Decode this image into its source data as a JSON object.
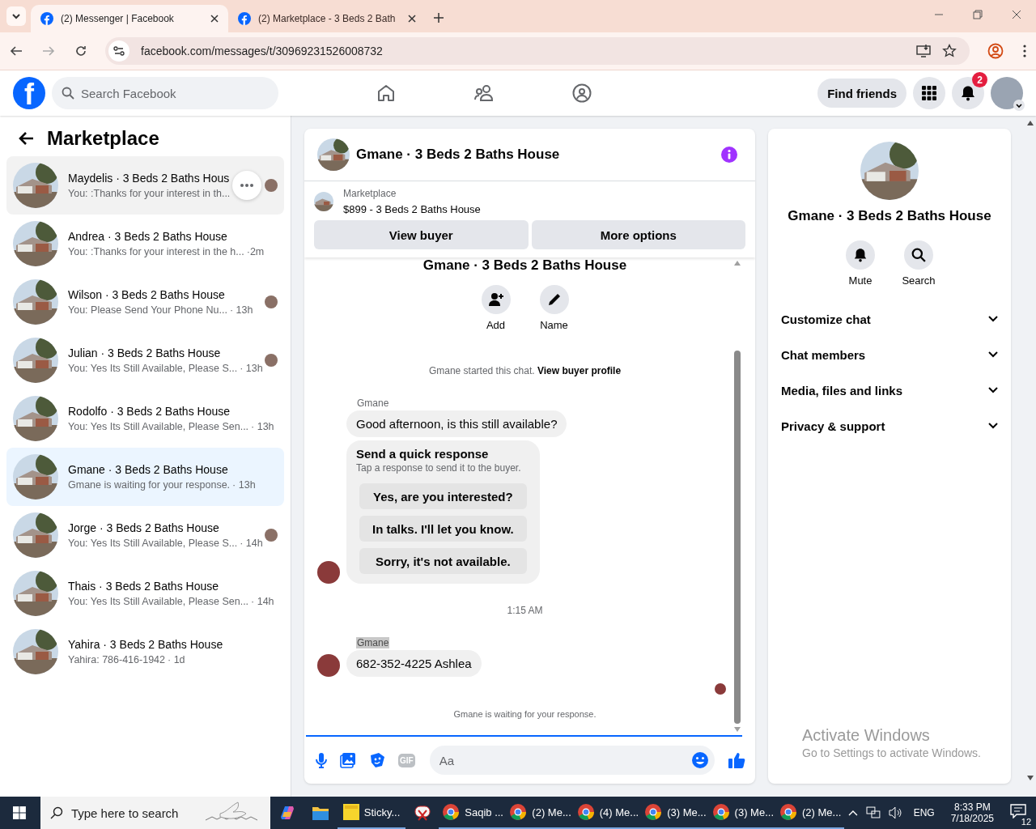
{
  "browser": {
    "tabs": [
      {
        "title": "(2) Messenger | Facebook",
        "selected": true
      },
      {
        "title": "(2) Marketplace - 3 Beds 2 Bath",
        "selected": false
      }
    ],
    "url": "facebook.com/messages/t/30969231526008732"
  },
  "header": {
    "logo": "f",
    "search": {
      "placeholder": "Search Facebook"
    },
    "find_friends": "Find friends",
    "notification_count": "2"
  },
  "sidebar": {
    "title": "Marketplace",
    "items": [
      {
        "name": "Maydelis · 3 Beds 2 Baths Hous",
        "preview": "You: :Thanks for your interest in th...",
        "selected": false,
        "hovered": true,
        "seen": true
      },
      {
        "name": "Andrea · 3 Beds 2 Baths House",
        "preview": "You: :Thanks for your interest in the h...",
        "time": "·2m",
        "selected": false,
        "hovered": false,
        "seen": false
      },
      {
        "name": "Wilson · 3 Beds 2 Baths House",
        "preview": "You: Please Send Your Phone Nu...",
        "time": "· 13h",
        "selected": false,
        "hovered": false,
        "seen": true
      },
      {
        "name": "Julian · 3 Beds 2 Baths House",
        "preview": "You: Yes Its Still Available, Please S...",
        "time": "· 13h",
        "selected": false,
        "hovered": false,
        "seen": true
      },
      {
        "name": "Rodolfo · 3 Beds 2 Baths House",
        "preview": "You: Yes Its Still Available, Please Sen...",
        "time": "· 13h",
        "selected": false,
        "hovered": false,
        "seen": false
      },
      {
        "name": "Gmane · 3 Beds 2 Baths House",
        "preview": "Gmane is waiting for your response.",
        "time": "· 13h",
        "selected": true,
        "hovered": false,
        "seen": false
      },
      {
        "name": "Jorge · 3 Beds 2 Baths House",
        "preview": "You: Yes Its Still Available, Please S...",
        "time": "· 14h",
        "selected": false,
        "hovered": false,
        "seen": true
      },
      {
        "name": "Thais · 3 Beds 2 Baths House",
        "preview": "You: Yes Its Still Available, Please Sen...",
        "time": "· 14h",
        "selected": false,
        "hovered": false,
        "seen": false
      },
      {
        "name": "Yahira · 3 Beds 2 Baths House",
        "preview": "Yahira: 786-416-1942",
        "time": "· 1d",
        "selected": false,
        "hovered": false,
        "seen": false
      }
    ]
  },
  "chat": {
    "title": "Gmane · 3 Beds 2 Baths House",
    "listing": {
      "label": "Marketplace",
      "text": "$899 - 3 Beds 2 Baths House"
    },
    "buttons": [
      "View buyer",
      "More options"
    ],
    "intro_title": "Gmane · 3 Beds 2 Baths House",
    "intro_actions": [
      {
        "kind": "add",
        "label": "Add"
      },
      {
        "kind": "name",
        "label": "Name"
      }
    ],
    "system": {
      "text": "Gmane started this chat.",
      "link": "View buyer profile"
    },
    "messages": [
      {
        "kind": "sender",
        "text": "Gmane",
        "highlighted": false
      },
      {
        "kind": "text",
        "text": "Good afternoon, is this still available?",
        "avatar": false
      },
      {
        "kind": "quick",
        "title": "Send a quick response",
        "subtitle": "Tap a response to send it to the buyer.",
        "options": [
          "Yes, are you interested?",
          "In talks. I'll let you know.",
          "Sorry, it's not available."
        ],
        "avatar": true
      },
      {
        "kind": "time",
        "text": "1:15 AM"
      },
      {
        "kind": "sender",
        "text": "Gmane",
        "highlighted": true
      },
      {
        "kind": "text",
        "text": "682-352-4225 Ashlea",
        "avatar": true
      },
      {
        "kind": "seen"
      }
    ],
    "footer": "Gmane is waiting for your response.",
    "composer": {
      "gif": "GIF",
      "placeholder": "Aa"
    }
  },
  "details": {
    "name": "Gmane · 3 Beds 2 Baths House",
    "actions": [
      {
        "kind": "mute",
        "label": "Mute"
      },
      {
        "kind": "search",
        "label": "Search"
      }
    ],
    "sections": [
      {
        "label": "Customize chat",
        "expanded": false
      },
      {
        "label": "Chat members",
        "expanded": false
      },
      {
        "label": "Media, files and links",
        "expanded": false
      },
      {
        "label": "Privacy & support",
        "expanded": false
      }
    ]
  },
  "watermark": {
    "title": "Activate Windows",
    "text": "Go to Settings to activate Windows."
  },
  "taskbar": {
    "search": {
      "placeholder": "Type here to search"
    },
    "apps": [
      {
        "kind": "copilot"
      },
      {
        "kind": "files"
      },
      {
        "kind": "sticky",
        "label": "Sticky..."
      },
      {
        "kind": "snip"
      },
      {
        "kind": "chrome",
        "label": "Saqib ..."
      },
      {
        "kind": "chrome",
        "label": "(2) Me..."
      },
      {
        "kind": "chrome",
        "label": "(4) Me..."
      },
      {
        "kind": "chrome",
        "label": "(3) Me..."
      },
      {
        "kind": "chrome",
        "label": "(3) Me..."
      },
      {
        "kind": "chrome",
        "label": "(2) Me..."
      }
    ],
    "language": "ENG",
    "time": "8:33 PM",
    "date": "7/18/2025",
    "notifications": "12"
  }
}
